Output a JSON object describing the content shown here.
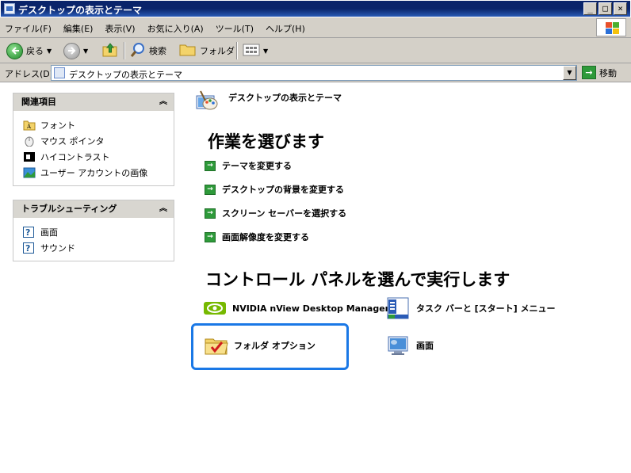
{
  "window": {
    "title": "デスクトップの表示とテーマ"
  },
  "menu": [
    "ファイル(F)",
    "編集(E)",
    "表示(V)",
    "お気に入り(A)",
    "ツール(T)",
    "ヘルプ(H)"
  ],
  "toolbar": {
    "back": "戻る",
    "search": "検索",
    "folders": "フォルダ"
  },
  "address": {
    "label": "アドレス(D)",
    "value": "デスクトップの表示とテーマ",
    "go": "移動"
  },
  "related": {
    "title": "関連項目",
    "items": [
      {
        "label": "フォント",
        "icon": "font-folder-icon"
      },
      {
        "label": "マウス ポインタ",
        "icon": "mouse-icon"
      },
      {
        "label": "ハイコントラスト",
        "icon": "high-contrast-icon"
      },
      {
        "label": "ユーザー アカウントの画像",
        "icon": "user-picture-icon"
      }
    ]
  },
  "troubleshoot": {
    "title": "トラブルシューティング",
    "items": [
      {
        "label": "画面",
        "icon": "help-icon"
      },
      {
        "label": "サウンド",
        "icon": "help-icon"
      }
    ]
  },
  "main": {
    "header": "デスクトップの表示とテーマ",
    "task_heading": "作業を選びます",
    "tasks": [
      "テーマを変更する",
      "デスクトップの背景を変更する",
      "スクリーン セーバーを選択する",
      "画面解像度を変更する"
    ],
    "cp_heading": "コントロール パネルを選んで実行します",
    "cp_items": [
      "NVIDIA nView Desktop Manager",
      "タスク バーと [スタート] メニュー",
      "フォルダ オプション",
      "画面"
    ]
  },
  "colors": {
    "focus": "#1a78e6",
    "title_bar": "#0a246a",
    "go_green": "#2e9a3a"
  }
}
